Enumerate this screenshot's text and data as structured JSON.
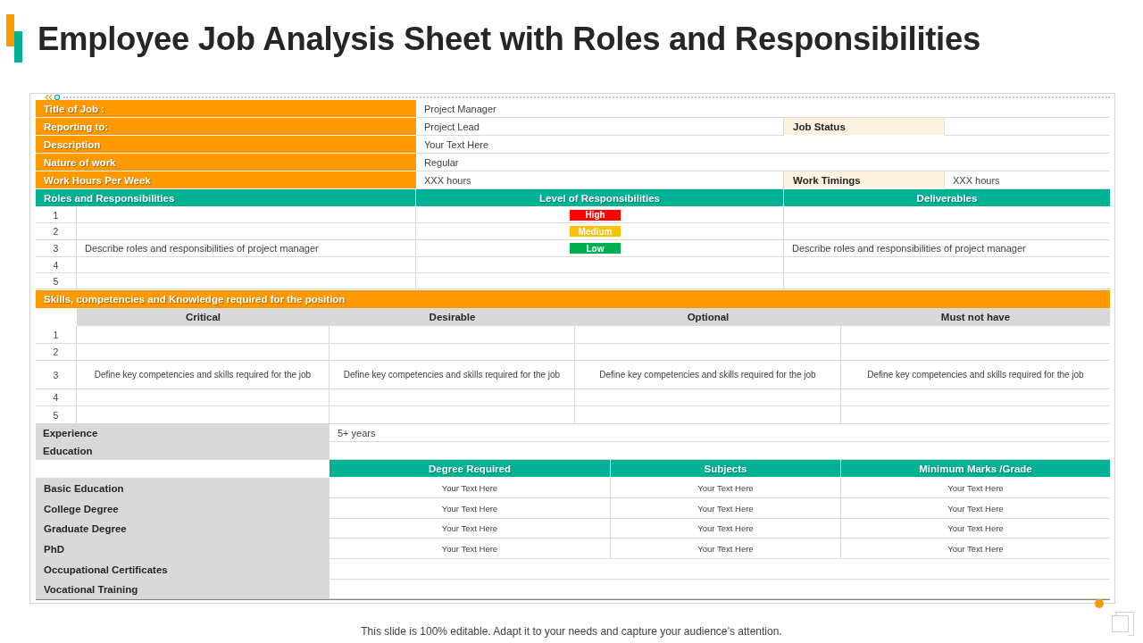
{
  "title": "Employee Job Analysis Sheet with Roles and Responsibilities",
  "job_info": [
    {
      "label": "Title of Job :",
      "value": "Project Manager"
    },
    {
      "label": "Reporting to:",
      "value": "Project Lead",
      "side_label": "Job Status"
    },
    {
      "label": "Description",
      "value": "Your Text Here"
    },
    {
      "label": "Nature of work",
      "value": "Regular"
    },
    {
      "label": "Work Hours Per Week",
      "value": "XXX hours",
      "side_label": "Work Timings",
      "side_value": "XXX hours"
    }
  ],
  "roles": {
    "headers": [
      "Roles and Responsibilities",
      "Level of Responsibilities",
      "Deliverables"
    ],
    "rows": [
      {
        "number": "1",
        "rating": "High",
        "color": "#ff0000"
      },
      {
        "number": "2",
        "rating": "Medium",
        "color": "#ffc000"
      },
      {
        "number": "3",
        "description": "Describe roles and responsibilities of project manager",
        "rating": "Low",
        "color": "#00b050",
        "deliverable": "Describe roles and responsibilities of project manager"
      },
      {
        "number": "4"
      },
      {
        "number": "5"
      }
    ]
  },
  "skills": {
    "title": "Skills, competencies and Knowledge required for the position",
    "columns": [
      "Critical",
      "Desirable",
      "Optional",
      "Must not have"
    ],
    "rows": [
      {
        "number": "1"
      },
      {
        "number": "2"
      },
      {
        "number": "3",
        "cells": [
          "Define key competencies and skills required for the job",
          "Define key competencies and skills required for the job",
          "Define key competencies and skills required for the job",
          "Define key competencies and skills required for the job"
        ]
      },
      {
        "number": "4"
      },
      {
        "number": "5"
      }
    ]
  },
  "experience": {
    "label": "Experience",
    "value": "5+ years"
  },
  "education": {
    "label": "Education",
    "columns": [
      "Degree Required",
      "Subjects",
      "Minimum Marks /Grade"
    ],
    "rows": [
      {
        "label": "Basic Education",
        "cells": [
          "Your Text Here",
          "Your Text Here",
          "Your Text Here"
        ]
      },
      {
        "label": "College Degree",
        "cells": [
          "Your Text Here",
          "Your Text Here",
          "Your Text Here"
        ]
      },
      {
        "label": "Graduate Degree",
        "cells": [
          "Your Text Here",
          "Your Text Here",
          "Your Text Here"
        ]
      },
      {
        "label": "PhD",
        "cells": [
          "Your Text Here",
          "Your Text Here",
          "Your Text Here"
        ]
      },
      {
        "label": "Occupational Certificates"
      },
      {
        "label": "Vocational Training"
      }
    ]
  },
  "footer": "This slide is 100% editable. Adapt it to your needs and capture your audience’s attention."
}
